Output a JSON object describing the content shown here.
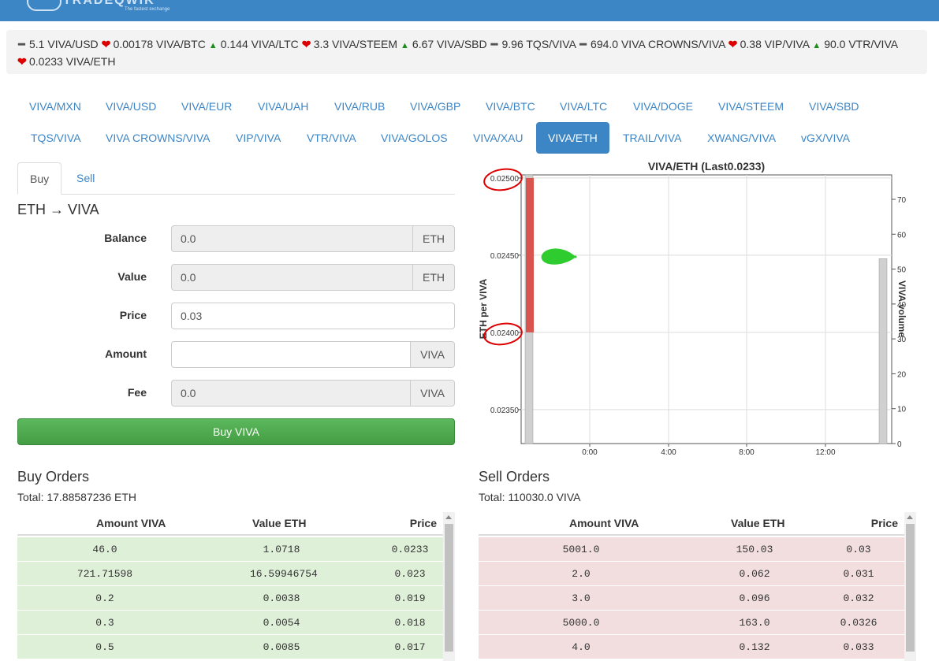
{
  "header": {
    "brand": "TRADEQWIK",
    "tagline": "The fastest exchange"
  },
  "ticker": [
    {
      "dir": "flat",
      "text": "5.1 VIVA/USD"
    },
    {
      "dir": "down",
      "text": "0.00178 VIVA/BTC"
    },
    {
      "dir": "up",
      "text": "0.144 VIVA/LTC"
    },
    {
      "dir": "down",
      "text": "3.3 VIVA/STEEM"
    },
    {
      "dir": "up",
      "text": "6.67 VIVA/SBD"
    },
    {
      "dir": "flat",
      "text": "9.96 TQS/VIVA"
    },
    {
      "dir": "flat",
      "text": "694.0 VIVA CROWNS/VIVA"
    },
    {
      "dir": "down",
      "text": "0.38 VIP/VIVA"
    },
    {
      "dir": "up",
      "text": "90.0 VTR/VIVA"
    },
    {
      "dir": "down",
      "text": "0.0233 VIVA/ETH"
    }
  ],
  "pairs": [
    "VIVA/MXN",
    "VIVA/USD",
    "VIVA/EUR",
    "VIVA/UAH",
    "VIVA/RUB",
    "VIVA/GBP",
    "VIVA/BTC",
    "VIVA/LTC",
    "VIVA/DOGE",
    "VIVA/STEEM",
    "VIVA/SBD",
    "TQS/VIVA",
    "VIVA CROWNS/VIVA",
    "VIP/VIVA",
    "VTR/VIVA",
    "VIVA/GOLOS",
    "VIVA/XAU",
    "VIVA/ETH",
    "TRAIL/VIVA",
    "XWANG/VIVA",
    "vGX/VIVA"
  ],
  "active_pair": "VIVA/ETH",
  "tabs": {
    "buy": "Buy",
    "sell": "Sell"
  },
  "form": {
    "title": "ETH → VIVA",
    "balance": {
      "label": "Balance",
      "value": "0.0",
      "unit": "ETH"
    },
    "value": {
      "label": "Value",
      "value": "0.0",
      "unit": "ETH"
    },
    "price": {
      "label": "Price",
      "value": "0.03"
    },
    "amount": {
      "label": "Amount",
      "value": "",
      "unit": "VIVA"
    },
    "fee": {
      "label": "Fee",
      "value": "0.0",
      "unit": "VIVA"
    },
    "submit": "Buy VIVA"
  },
  "chart_data": {
    "type": "bar",
    "title": "VIVA/ETH (Last0.0233)",
    "ylabel": "ETH per VIVA",
    "y2label": "VIVA volume",
    "ylim": [
      0.02328,
      0.02502
    ],
    "y2lim": [
      0,
      77
    ],
    "y_ticks": [
      0.0235,
      0.024,
      0.0245,
      0.025
    ],
    "y2_ticks": [
      0,
      10,
      20,
      30,
      40,
      50,
      60,
      70
    ],
    "x_ticks": [
      "0:00",
      "4:00",
      "8:00",
      "12:00"
    ],
    "candles": [
      {
        "open": 0.025,
        "close": 0.024
      }
    ],
    "volume": [
      77,
      53
    ],
    "colors": {
      "down": "#d9534f",
      "volume": "#d0d0d0"
    }
  },
  "buy_orders": {
    "title": "Buy Orders",
    "total": "Total: 17.88587236 ETH",
    "columns": [
      "Amount VIVA",
      "Value ETH",
      "Price"
    ],
    "rows": [
      [
        "46.0",
        "1.0718",
        "0.0233"
      ],
      [
        "721.71598",
        "16.59946754",
        "0.023"
      ],
      [
        "0.2",
        "0.0038",
        "0.019"
      ],
      [
        "0.3",
        "0.0054",
        "0.018"
      ],
      [
        "0.5",
        "0.0085",
        "0.017"
      ]
    ]
  },
  "sell_orders": {
    "title": "Sell Orders",
    "total": "Total: 110030.0 VIVA",
    "columns": [
      "Amount VIVA",
      "Value ETH",
      "Price"
    ],
    "rows": [
      [
        "5001.0",
        "150.03",
        "0.03"
      ],
      [
        "2.0",
        "0.062",
        "0.031"
      ],
      [
        "3.0",
        "0.096",
        "0.032"
      ],
      [
        "5000.0",
        "163.0",
        "0.0326"
      ],
      [
        "4.0",
        "0.132",
        "0.033"
      ]
    ]
  }
}
